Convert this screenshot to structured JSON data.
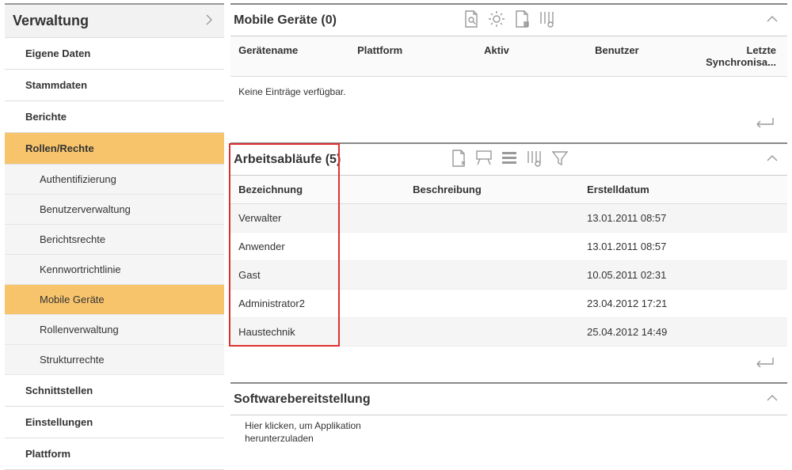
{
  "sidebar": {
    "title": "Verwaltung",
    "items": [
      {
        "label": "Eigene Daten",
        "active": false
      },
      {
        "label": "Stammdaten",
        "active": false
      },
      {
        "label": "Berichte",
        "active": false
      },
      {
        "label": "Rollen/Rechte",
        "active": true,
        "children": [
          {
            "label": "Authentifizierung",
            "active": false
          },
          {
            "label": "Benutzerverwaltung",
            "active": false
          },
          {
            "label": "Berichtsrechte",
            "active": false
          },
          {
            "label": "Kennwortrichtlinie",
            "active": false
          },
          {
            "label": "Mobile Geräte",
            "active": true
          },
          {
            "label": "Rollenverwaltung",
            "active": false
          },
          {
            "label": "Strukturrechte",
            "active": false
          }
        ]
      },
      {
        "label": "Schnittstellen",
        "active": false
      },
      {
        "label": "Einstellungen",
        "active": false
      },
      {
        "label": "Plattform",
        "active": false
      }
    ]
  },
  "panels": {
    "devices": {
      "title": "Mobile Geräte (0)",
      "columns": [
        "Gerätename",
        "Plattform",
        "Aktiv",
        "Benutzer",
        "Letzte Synchronisa..."
      ],
      "empty": "Keine Einträge verfügbar."
    },
    "workflows": {
      "title": "Arbeitsabläufe (5)",
      "columns": [
        "Bezeichnung",
        "Beschreibung",
        "Erstelldatum"
      ],
      "rows": [
        {
          "name": "Verwalter",
          "desc": "",
          "date": "13.01.2011 08:57"
        },
        {
          "name": "Anwender",
          "desc": "",
          "date": "13.01.2011 08:57"
        },
        {
          "name": "Gast",
          "desc": "",
          "date": "10.05.2011 02:31"
        },
        {
          "name": "Administrator2",
          "desc": "",
          "date": "23.04.2012 17:21"
        },
        {
          "name": "Haustechnik",
          "desc": "",
          "date": "25.04.2012 14:49"
        }
      ]
    },
    "software": {
      "title": "Softwarebereitstellung",
      "hint": "Hier klicken, um Applikation herunterzuladen"
    }
  },
  "icons": {
    "search_doc": "search-doc-icon",
    "gear": "gear-icon",
    "delete_doc": "delete-doc-icon",
    "columns": "columns-config-icon",
    "new_doc": "new-doc-icon",
    "assign": "assign-icon",
    "list": "list-icon",
    "filter": "filter-icon"
  }
}
